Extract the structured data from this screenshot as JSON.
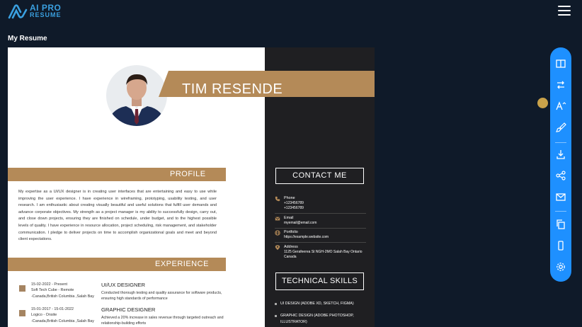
{
  "app": {
    "logo_line1": "AI PRO",
    "logo_line2": "RESUME",
    "page_title": "My Resume"
  },
  "resume": {
    "name": "TIM RESENDE",
    "role": "UI UX DESIGNER",
    "profile_title": "PROFILE",
    "profile_text": "My expertise as a UI/UX designer is in creating user interfaces that are entertaining and easy to use while improving the user experience. I have experience in wireframing, prototyping, usability testing, and user research. I am enthusiastic about creating visually beautiful and useful solutions that fulfill user demands and advance corporate objectives. My strength as a project manager is my ability to successfully design, carry out, and close down projects, ensuring they are finished on schedule, under budget, and to the highest possible levels of quality. I have experience in resource allocation, project scheduling, risk management, and stakeholder communication. I pledge to deliver projects on time to accomplish organizational goals and meet and beyond client expectations.",
    "experience_title": "EXPERIENCE",
    "experience": [
      {
        "dates": "15-02-2022 - Present",
        "company": "Soft Tech Cube - Remote",
        "location": "-Canada,British Columbia ,Salah Bay",
        "role": "UI/UX DESIGNER",
        "description": "Conducted thorough testing and quality assurance for software products, ensuring high standards of performance"
      },
      {
        "dates": "15-01-2017 - 15-01-2022",
        "company": "Logico - Onsite",
        "location": "-Canada,British Columbia ,Salah Bay",
        "role": "GRAPHIC DESIGNER",
        "description": "Achieved a 20% increase in sales revenue through targeted outreach and relationship-building efforts"
      }
    ],
    "contact_title": "CONTACT ME",
    "contact": {
      "phone_label": "Phone",
      "phone_values": [
        "+123456789",
        "+123456789"
      ],
      "email_label": "Email",
      "email_value": "myemail@email.com",
      "portfolio_label": "Portfolio",
      "portfolio_value": "https://example.website.com",
      "address_label": "Address",
      "address_value": "1125 Gerafeerea St NGH-2MO Salah Bay Ontario Canada"
    },
    "skills_title": "TECHNICAL SKILLS",
    "skills": [
      "UI DESIGN (ADOBE XD, SKETCH, FIGMA)",
      "GRAPHIC DESIGN (ADOBE PHOTOSHOP, ILLUSTRATOR)"
    ]
  },
  "toolbar": {
    "buttons": [
      "layout-icon",
      "swap-icon",
      "font-size-icon",
      "paint-brush-icon",
      "download-icon",
      "share-icon",
      "email-icon",
      "copy-icon",
      "mobile-icon",
      "settings-icon"
    ]
  },
  "colors": {
    "background": "#0f1a29",
    "accent_gold": "#b48a58",
    "toolbar_blue": "#1e90ff",
    "resume_sidebar": "#1f1f22"
  }
}
